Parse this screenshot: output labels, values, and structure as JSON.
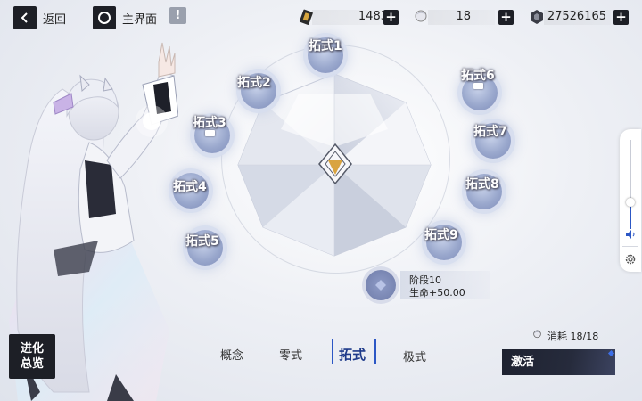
{
  "topbar": {
    "back_label": "返回",
    "home_label": "主界面",
    "info_icon": "info-icon",
    "resources": [
      {
        "icon": "ticket-icon",
        "value": "1483"
      },
      {
        "icon": "character-head-icon",
        "value": "18"
      },
      {
        "icon": "coin-icon",
        "value": "27526165"
      }
    ]
  },
  "nodes": [
    {
      "label": "拓式1",
      "badge": false
    },
    {
      "label": "拓式2",
      "badge": false
    },
    {
      "label": "拓式3",
      "badge": true
    },
    {
      "label": "拓式4",
      "badge": false
    },
    {
      "label": "拓式5",
      "badge": false
    },
    {
      "label": "拓式6",
      "badge": true
    },
    {
      "label": "拓式7",
      "badge": false
    },
    {
      "label": "拓式8",
      "badge": false
    },
    {
      "label": "拓式9",
      "badge": false
    }
  ],
  "stage": {
    "title": "阶段10",
    "bonus": "生命+50.00"
  },
  "tabs": [
    {
      "label": "概念",
      "active": false
    },
    {
      "label": "零式",
      "active": false
    },
    {
      "label": "拓式",
      "active": true
    },
    {
      "label": "极式",
      "active": false
    }
  ],
  "overview": {
    "line1": "进化",
    "line2": "总览"
  },
  "cost": {
    "label": "消耗 18/18"
  },
  "activate_label": "激活",
  "side_panel": {
    "slider_level": 0.3,
    "icons": [
      "speaker-icon",
      "settings-icon"
    ]
  },
  "colors": {
    "accent": "#2c57c5",
    "dark": "#1d1f26",
    "node": "#8e9bc6",
    "emblem_gold": "#d9a441"
  }
}
